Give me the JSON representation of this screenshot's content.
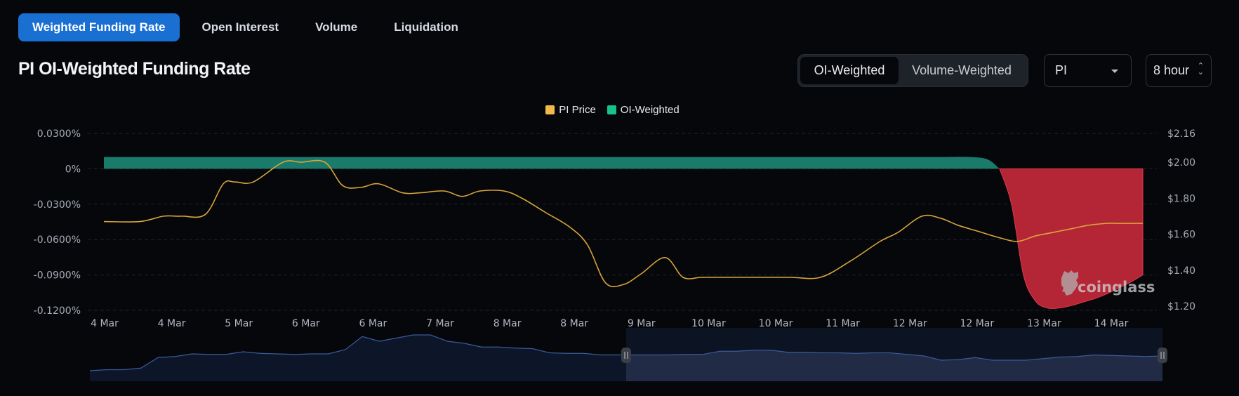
{
  "tabs": [
    {
      "label": "Weighted Funding Rate",
      "active": true
    },
    {
      "label": "Open Interest",
      "active": false
    },
    {
      "label": "Volume",
      "active": false
    },
    {
      "label": "Liquidation",
      "active": false
    }
  ],
  "page_title": "PI OI-Weighted Funding Rate",
  "weighting_toggle": {
    "options": [
      "OI-Weighted",
      "Volume-Weighted"
    ],
    "selected": "OI-Weighted"
  },
  "coin_select": {
    "value": "PI",
    "icon": "caret-down-icon"
  },
  "interval_select": {
    "value": "8 hour",
    "icon": "up-down-chevron-icon"
  },
  "watermark": "coinglass",
  "colors": {
    "background": "#05070b",
    "tab_active": "#1a6fd3",
    "price_line": "#d9a53a",
    "positive_fill": "#1b7b6b",
    "negative_fill": "#b42636",
    "legend_price": "#f0b94a",
    "legend_oi": "#17c389",
    "navigator_line": "#3b5a9a"
  },
  "chart_data": {
    "type": "area",
    "title": "PI OI-Weighted Funding Rate",
    "legend": [
      {
        "name": "PI Price",
        "color": "#f0b94a"
      },
      {
        "name": "OI-Weighted",
        "color": "#17c389"
      }
    ],
    "legend_position": "top-center",
    "x_tick_labels": [
      "4 Mar",
      "4 Mar",
      "5 Mar",
      "6 Mar",
      "6 Mar",
      "7 Mar",
      "8 Mar",
      "8 Mar",
      "9 Mar",
      "10 Mar",
      "10 Mar",
      "11 Mar",
      "12 Mar",
      "12 Mar",
      "13 Mar",
      "14 Mar"
    ],
    "y_left": {
      "ticks": [
        "0.0300%",
        "0%",
        "-0.0300%",
        "-0.0600%",
        "-0.0900%",
        "-0.1200%"
      ],
      "range": [
        -0.12,
        0.03
      ],
      "unit": "%"
    },
    "y_right": {
      "ticks": [
        "$2.16",
        "$2.00",
        "$1.80",
        "$1.60",
        "$1.40",
        "$1.20"
      ],
      "range": [
        1.2,
        2.16
      ],
      "unit": "$"
    },
    "grid": true,
    "series": [
      {
        "name": "OI-Weighted",
        "axis": "left",
        "x": [
          0,
          0.5,
          1,
          2,
          3,
          4,
          5,
          6,
          7,
          8,
          9,
          10,
          11,
          12,
          13,
          14,
          14.5,
          14.8,
          15.0,
          15.2,
          15.4,
          15.6,
          15.8,
          16.0,
          16.2,
          16.4,
          16.6,
          16.8,
          17.0,
          17.2,
          17.4
        ],
        "values": [
          0.01,
          0.01,
          0.01,
          0.01,
          0.01,
          0.01,
          0.01,
          0.01,
          0.01,
          0.01,
          0.01,
          0.01,
          0.01,
          0.01,
          0.01,
          0.01,
          0.01,
          0.008,
          0.0,
          -0.03,
          -0.09,
          -0.112,
          -0.118,
          -0.118,
          -0.116,
          -0.113,
          -0.11,
          -0.106,
          -0.101,
          -0.096,
          -0.09
        ]
      },
      {
        "name": "PI Price",
        "axis": "right",
        "x": [
          0,
          0.6,
          1.0,
          1.3,
          1.7,
          2.0,
          2.2,
          2.5,
          3.0,
          3.3,
          3.7,
          4.0,
          4.3,
          4.6,
          5.0,
          5.3,
          5.7,
          6.0,
          6.3,
          6.7,
          7.0,
          7.4,
          7.8,
          8.1,
          8.4,
          8.7,
          9.0,
          9.4,
          9.7,
          10.0,
          10.3,
          10.6,
          11.0,
          11.5,
          12.0,
          12.5,
          13.0,
          13.3,
          13.7,
          14.0,
          14.3,
          14.6,
          15.0,
          15.3,
          15.6,
          15.9,
          16.2,
          16.5,
          16.8,
          17.0,
          17.4
        ],
        "values": [
          1.67,
          1.67,
          1.7,
          1.7,
          1.71,
          1.88,
          1.89,
          1.89,
          2.0,
          2.0,
          2.0,
          1.87,
          1.86,
          1.88,
          1.83,
          1.83,
          1.84,
          1.81,
          1.84,
          1.84,
          1.8,
          1.72,
          1.64,
          1.54,
          1.33,
          1.32,
          1.38,
          1.47,
          1.36,
          1.36,
          1.36,
          1.36,
          1.36,
          1.36,
          1.36,
          1.45,
          1.56,
          1.61,
          1.7,
          1.69,
          1.65,
          1.62,
          1.58,
          1.56,
          1.59,
          1.61,
          1.63,
          1.65,
          1.66,
          1.66,
          1.66
        ]
      }
    ],
    "navigator": {
      "values": [
        0.2,
        0.22,
        0.22,
        0.25,
        0.45,
        0.47,
        0.52,
        0.51,
        0.51,
        0.56,
        0.53,
        0.52,
        0.51,
        0.52,
        0.52,
        0.6,
        0.85,
        0.76,
        0.82,
        0.88,
        0.88,
        0.76,
        0.72,
        0.65,
        0.65,
        0.63,
        0.62,
        0.54,
        0.53,
        0.53,
        0.5,
        0.5,
        0.5,
        0.5,
        0.5,
        0.51,
        0.51,
        0.57,
        0.57,
        0.59,
        0.59,
        0.55,
        0.55,
        0.54,
        0.54,
        0.53,
        0.54,
        0.54,
        0.51,
        0.48,
        0.4,
        0.41,
        0.45,
        0.4,
        0.4,
        0.4,
        0.43,
        0.46,
        0.47,
        0.5,
        0.49,
        0.48,
        0.47,
        0.48
      ],
      "selection": [
        0.5,
        1.0
      ]
    }
  }
}
